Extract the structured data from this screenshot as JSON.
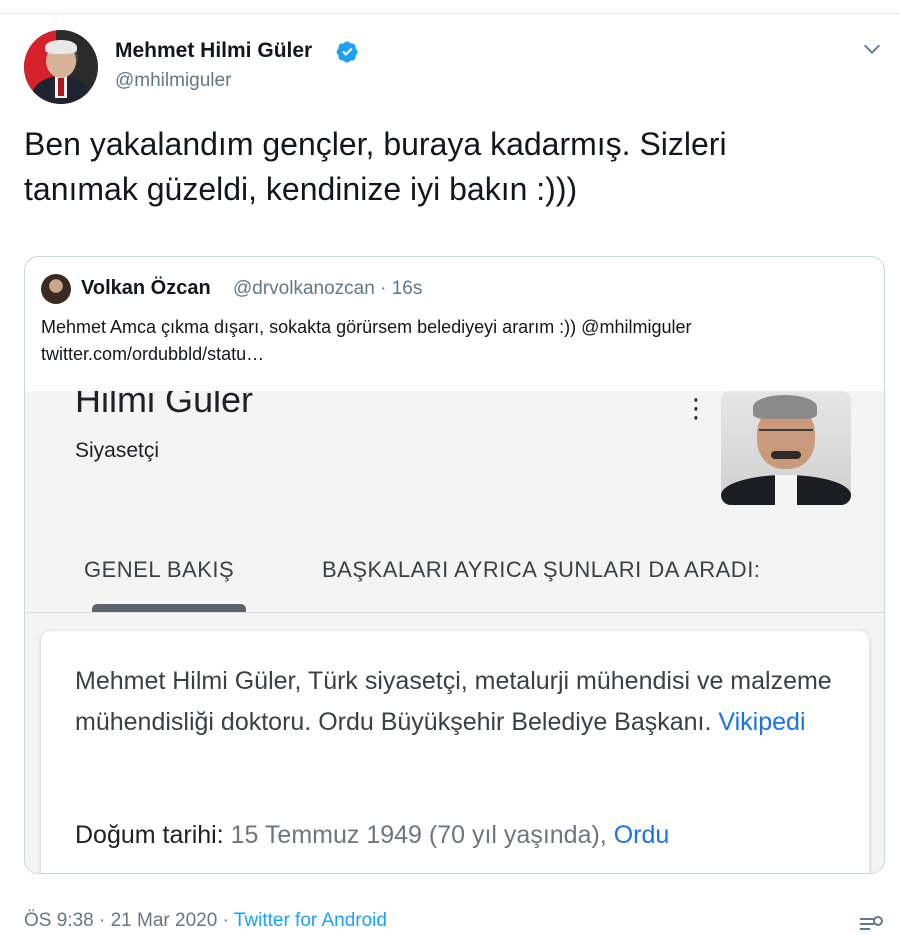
{
  "tweet": {
    "author": {
      "name": "Mehmet Hilmi Güler",
      "handle": "@mhilmiguler",
      "verified": true
    },
    "text": "Ben yakalandım gençler, buraya kadarmış. Sizleri\ntanımak güzeldi, kendinize iyi bakın :)))",
    "icons": {
      "menu": "chevron-down-icon",
      "verified": "verified-badge-icon"
    }
  },
  "quote": {
    "name": "Volkan Özcan",
    "meta": "@drvolkanozcan · 16s",
    "text": "Mehmet Amca çıkma dışarı, sokakta görürsem belediyeyi ararım :)) @mhilmiguler twitter.com/ordubbld/statu…",
    "image": {
      "title": "Hilmi Güler",
      "subtitle": "Siyasetçi",
      "tab_overview": "GENEL BAKIŞ",
      "tab_related": "BAŞKALARI AYRICA ŞUNLARI DA ARADI:",
      "description": "Mehmet Hilmi Güler, Türk siyasetçi, metalurji mühendisi ve malzeme mühendisliği doktoru. Ordu Büyükşehir Belediye Başkanı.",
      "description_link": "Vikipedi",
      "birth_label": "Doğum tarihi:",
      "birth_value": "15 Temmuz 1949 (70 yıl yaşında),",
      "birth_place": "Ordu"
    }
  },
  "footer": {
    "timestamp": "ÖS 9:38 · 21 Mar 2020 ·",
    "source": "Twitter for Android"
  },
  "colors": {
    "accent": "#1da1f2",
    "secondary_text": "#657786",
    "link": "#1a73e8"
  }
}
